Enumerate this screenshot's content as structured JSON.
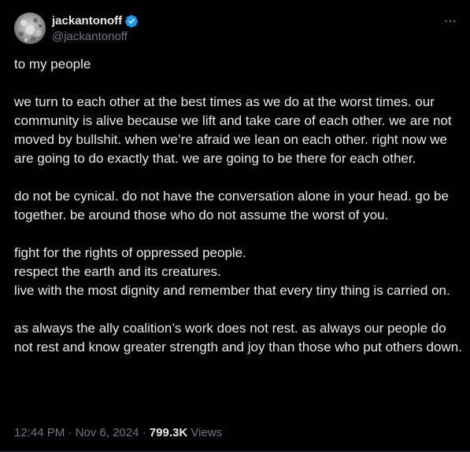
{
  "colors": {
    "background": "#000000",
    "text": "#e7e9ea",
    "muted": "#71767b",
    "verified_badge": "#1d9bf0",
    "divider": "#2f3336"
  },
  "author": {
    "display_name": "jackantonoff",
    "handle": "@jackantonoff",
    "verified": true,
    "avatar_icon": "avatar-photo",
    "verified_icon": "verified-badge-icon"
  },
  "more_icon": "more-options-icon",
  "tweet": {
    "paragraphs": [
      [
        "to my people"
      ],
      [
        "we turn to each other at the best times as we do at the worst times. our community is alive because we lift and take care of each other. we are not moved by bullshit. when we’re afraid we lean on each other. right now we are going to do exactly that. we are going to be there for each other."
      ],
      [
        "do not be cynical. do not have the conversation alone in your head. go be together. be around those who do not assume the worst of you."
      ],
      [
        "fight for the rights of oppressed people.",
        "respect the earth and its creatures.",
        "live with the most dignity and remember that every tiny thing is carried on."
      ],
      [
        "as always the ally coalition’s work does not rest. as always our people do not rest and know greater strength and joy than those who put others down."
      ]
    ]
  },
  "meta": {
    "time": "12:44 PM",
    "separator": "·",
    "date": "Nov 6, 2024",
    "views_count": "799.3K",
    "views_label": "Views"
  }
}
